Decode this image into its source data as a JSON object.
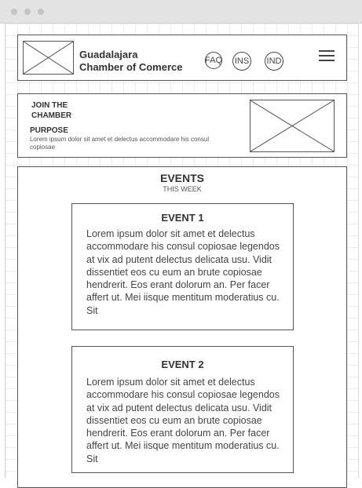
{
  "header": {
    "brand_line1": "Guadalajara",
    "brand_line2": "Chamber of Comerce",
    "nav": [
      "FAQ",
      "INS",
      "IND"
    ]
  },
  "join": {
    "title_line1": "JOIN THE",
    "title_line2": "CHAMBER",
    "purpose_title": "PURPOSE",
    "purpose_text": "Lorem ipsum dolor sit amet et delectus accommodare his consul copiosae"
  },
  "events": {
    "title": "EVENTS",
    "subtitle": "THIS WEEK",
    "items": [
      {
        "title": "EVENT 1",
        "text": "Lorem ipsum dolor sit amet et delectus accommodare his consul copiosae legendos at vix ad putent delectus delicata usu. Vidit dissentiet eos cu eum an brute copiosae hendrerit. Eos erant dolorum an. Per facer affert ut. Mei iisque mentitum moderatius cu. Sit"
      },
      {
        "title": "EVENT 2",
        "text": "Lorem ipsum dolor sit amet et delectus accommodare his consul copiosae legendos at vix ad putent delectus delicata usu. Vidit dissentiet eos cu eum an brute copiosae hendrerit. Eos erant dolorum an. Per facer affert ut. Mei iisque mentitum moderatius cu. Sit"
      }
    ]
  }
}
